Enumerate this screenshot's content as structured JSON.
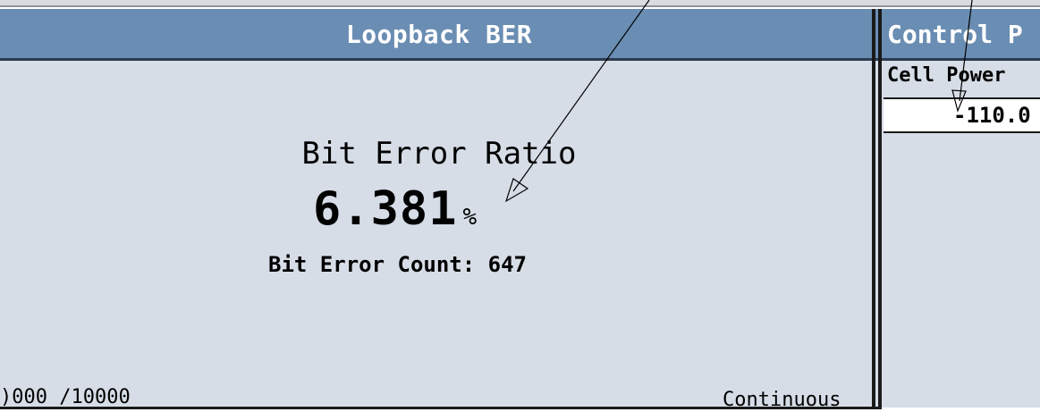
{
  "main": {
    "title": "Loopback BER",
    "ber_label": "Bit Error Ratio",
    "ber_value": "6.381",
    "ber_unit": "%",
    "error_count": "Bit Error Count: 647",
    "progress": ")000 /10000",
    "mode": "Continuous"
  },
  "control": {
    "title": "Control P",
    "field_label": "Cell Power",
    "field_value": "-110.0"
  },
  "colors": {
    "header": "#6a8db3",
    "panel_bg": "#d6dde7"
  }
}
